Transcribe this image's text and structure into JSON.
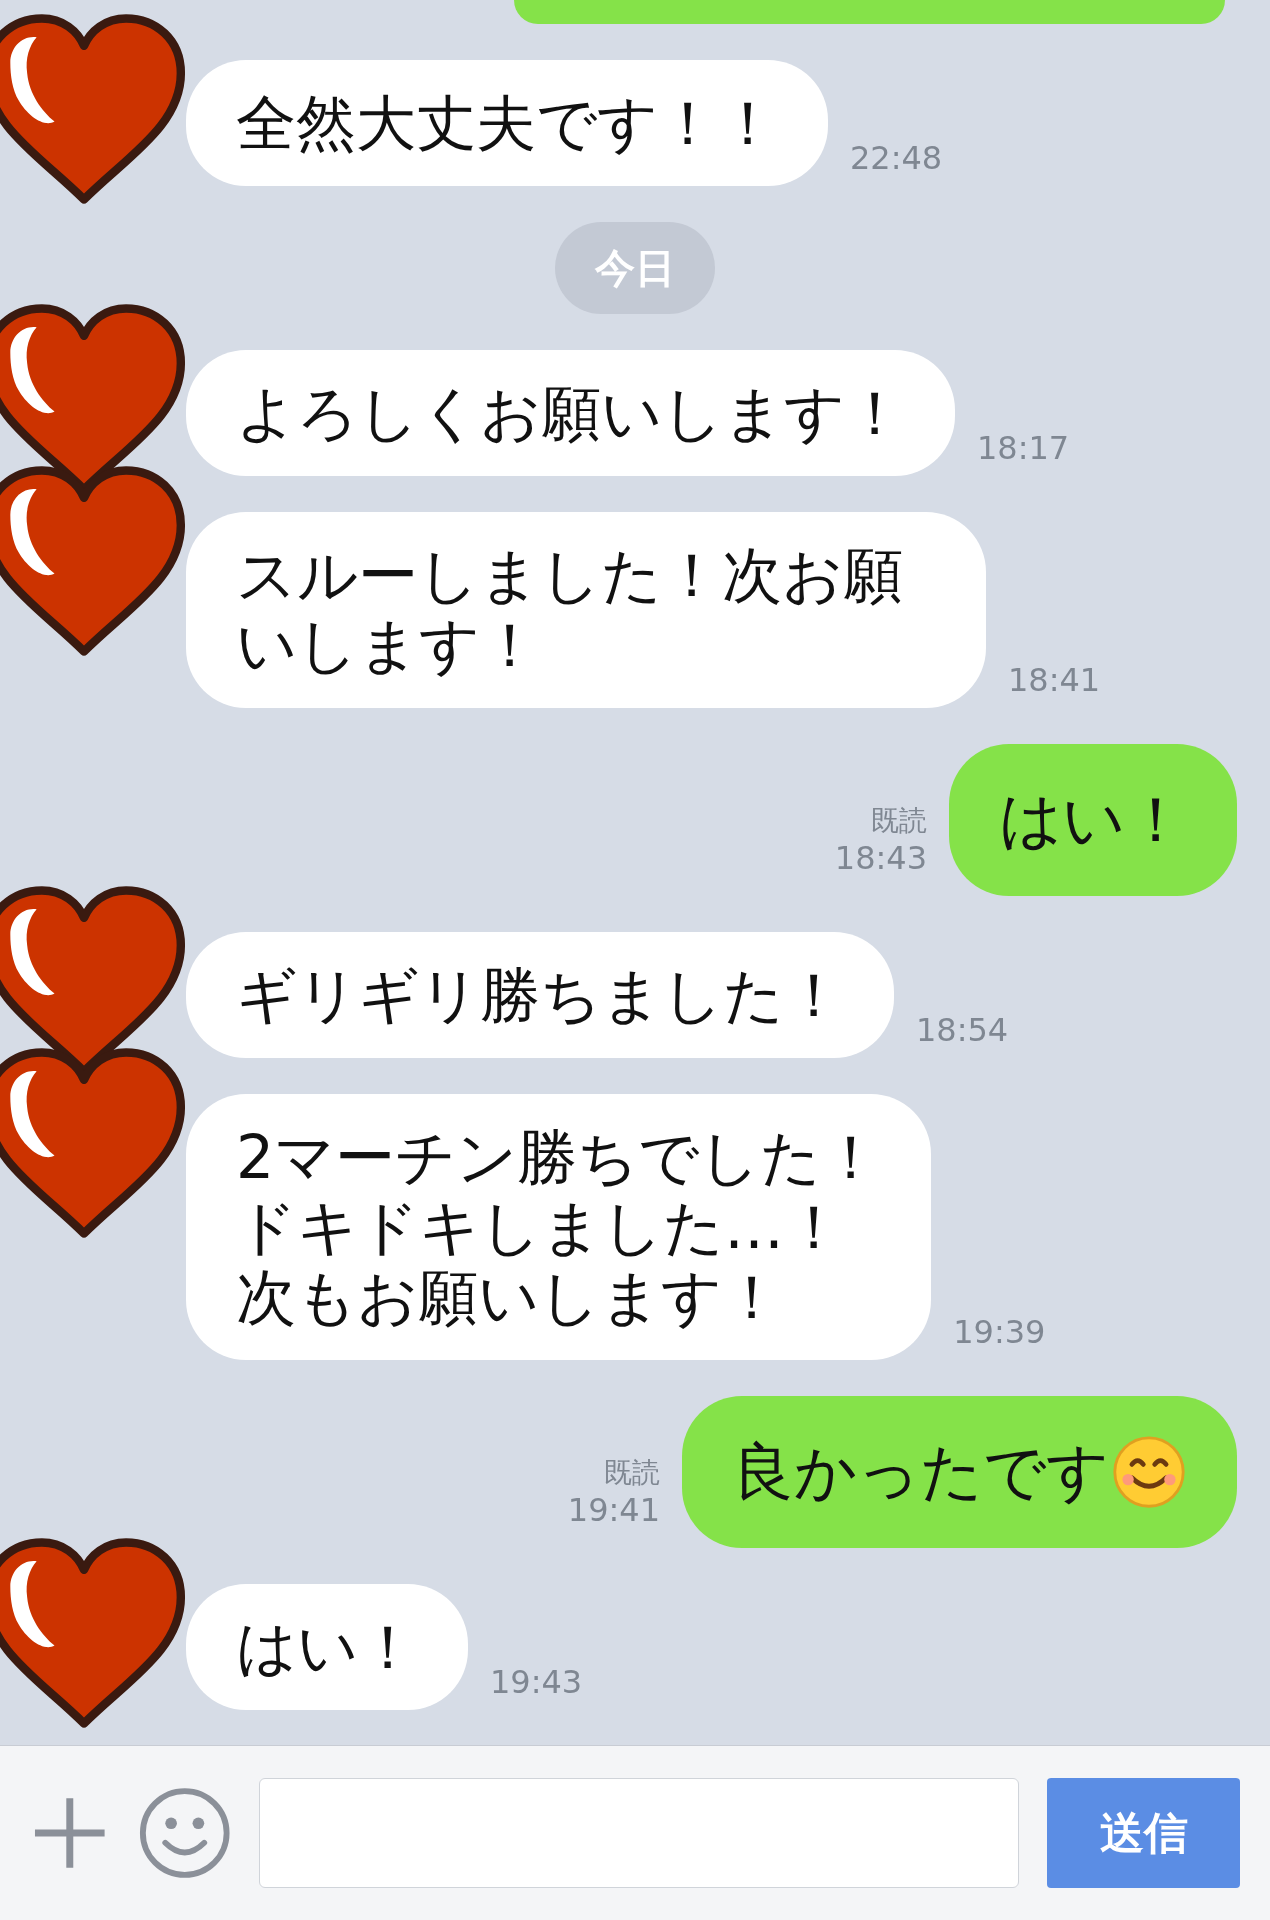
{
  "messages": [
    {
      "kind": "cut_bubble"
    },
    {
      "kind": "incoming",
      "text": "全然大丈夫です！！",
      "time": "22:48"
    },
    {
      "kind": "date",
      "text": "今日"
    },
    {
      "kind": "incoming",
      "text": "よろしくお願いします！",
      "time": "18:17"
    },
    {
      "kind": "incoming",
      "text": "スルーしました！次お願いします！",
      "time": "18:41"
    },
    {
      "kind": "outgoing",
      "text": "はい！",
      "time": "18:43",
      "read": true,
      "read_label": "既読"
    },
    {
      "kind": "incoming",
      "text": "ギリギリ勝ちました！",
      "time": "18:54"
    },
    {
      "kind": "incoming",
      "lines": [
        "2マーチン勝ちでした！",
        "ドキドキしました…！",
        "次もお願いします！"
      ],
      "time": "19:39"
    },
    {
      "kind": "outgoing",
      "text": "良かったです",
      "smiley": true,
      "time": "19:41",
      "read": true,
      "read_label": "既読"
    },
    {
      "kind": "incoming",
      "text": "はい！",
      "time": "19:43"
    }
  ],
  "send_button": "送信"
}
